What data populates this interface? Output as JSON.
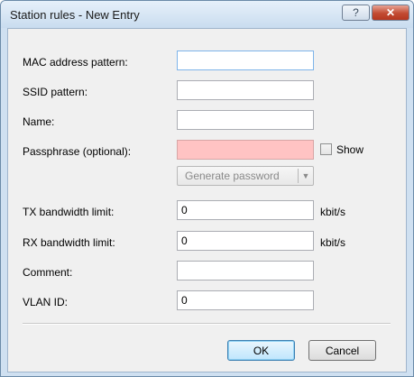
{
  "window": {
    "title": "Station rules - New Entry",
    "help_label": "?",
    "close_label": "✕"
  },
  "form": {
    "mac_label": "MAC address pattern:",
    "mac_value": "",
    "ssid_label": "SSID pattern:",
    "ssid_value": "",
    "name_label": "Name:",
    "name_value": "",
    "passphrase_label": "Passphrase (optional):",
    "passphrase_value": "",
    "show_label": "Show",
    "show_checked": false,
    "generate_label": "Generate password",
    "tx_label": "TX bandwidth limit:",
    "tx_value": "0",
    "tx_unit": "kbit/s",
    "rx_label": "RX bandwidth limit:",
    "rx_value": "0",
    "rx_unit": "kbit/s",
    "comment_label": "Comment:",
    "comment_value": "",
    "vlan_label": "VLAN ID:",
    "vlan_value": "0"
  },
  "buttons": {
    "ok": "OK",
    "cancel": "Cancel"
  },
  "colors": {
    "passphrase_invalid_bg": "#ffc3c3",
    "close_button": "#c24b32"
  }
}
